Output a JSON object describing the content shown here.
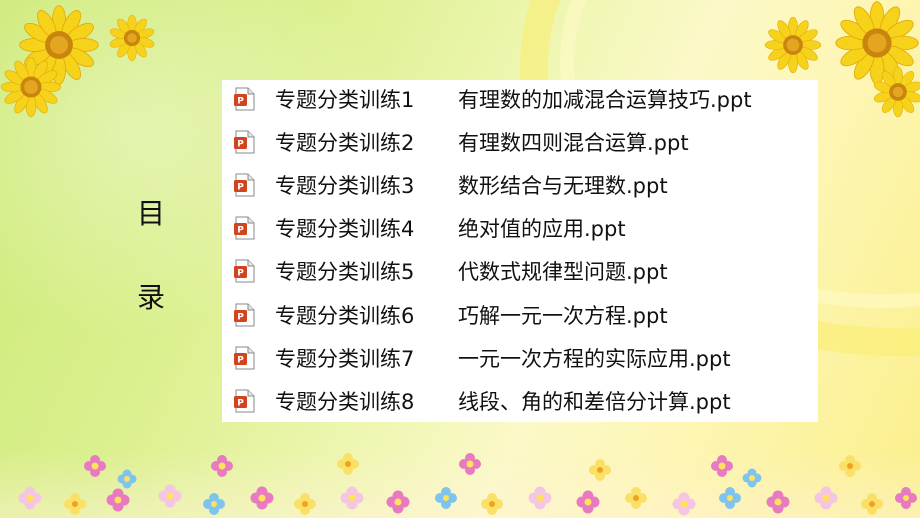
{
  "title_chars": [
    "目",
    "录"
  ],
  "items": [
    {
      "series": "专题分类训练1",
      "name": "有理数的加减混合运算技巧.ppt"
    },
    {
      "series": "专题分类训练2",
      "name": "有理数四则混合运算.ppt"
    },
    {
      "series": "专题分类训练3",
      "name": "数形结合与无理数.ppt"
    },
    {
      "series": "专题分类训练4",
      "name": "绝对值的应用.ppt"
    },
    {
      "series": "专题分类训练5",
      "name": "代数式规律型问题.ppt"
    },
    {
      "series": "专题分类训练6",
      "name": "巧解一元一次方程.ppt"
    },
    {
      "series": "专题分类训练7",
      "name": "一元一次方程的实际应用.ppt"
    },
    {
      "series": "专题分类训练8",
      "name": "线段、角的和差倍分计算.ppt"
    }
  ],
  "icons": {
    "file": "powerpoint-file-icon",
    "decoration": "sunflower-icon"
  },
  "colors": {
    "sunflower_petal": "#f7d21a",
    "sunflower_center": "#c8860e",
    "file_icon": "#d2431f"
  }
}
